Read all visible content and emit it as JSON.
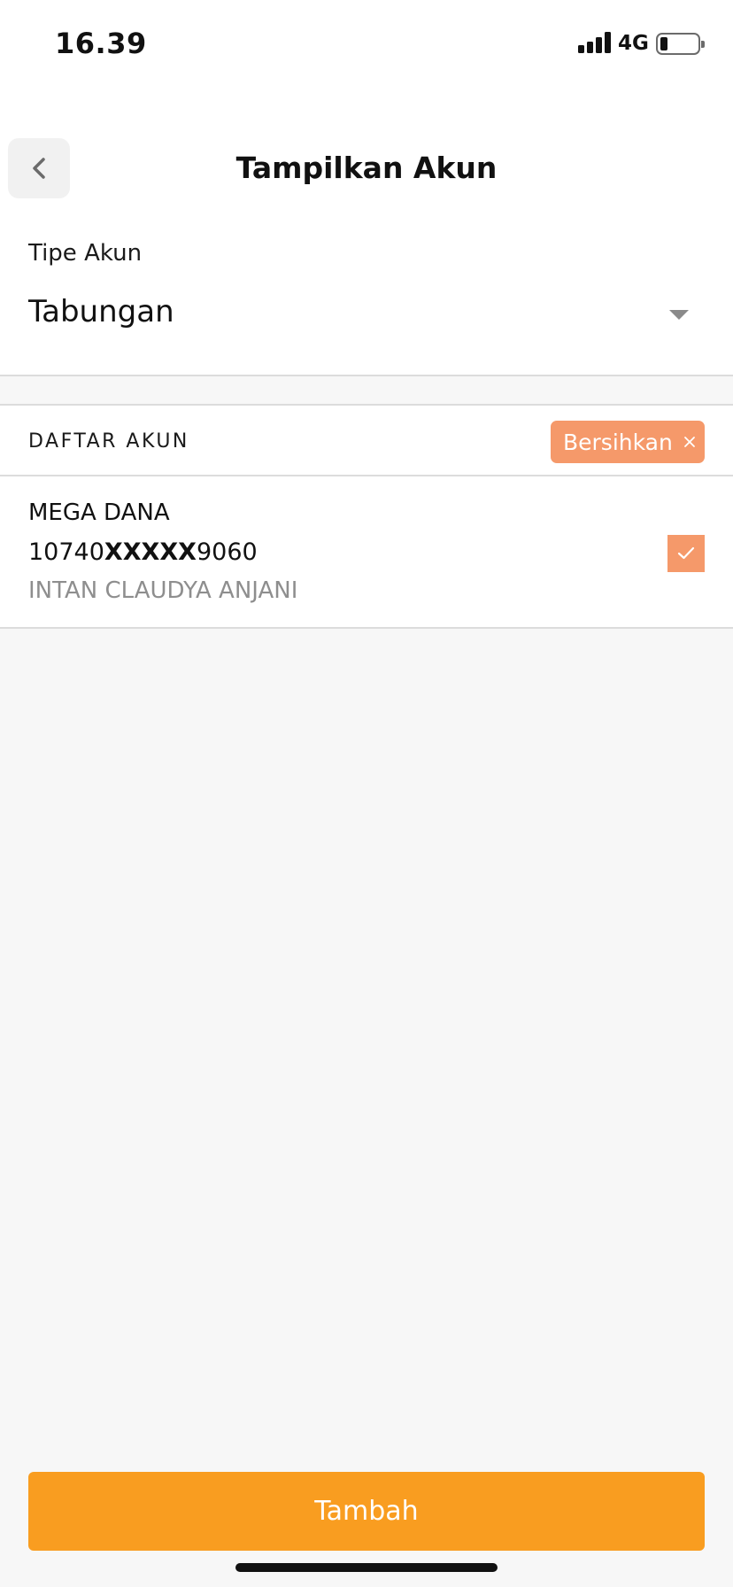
{
  "status_bar": {
    "time": "16.39",
    "network": "4G",
    "battery_fraction": 0.2
  },
  "header": {
    "title": "Tampilkan Akun",
    "back_icon": "chevron-left-icon"
  },
  "account_type": {
    "label": "Tipe Akun",
    "selected": "Tabungan"
  },
  "account_list": {
    "title": "DAFTAR AKUN",
    "clear_label": "Bersihkan",
    "items": [
      {
        "bank": "MEGA DANA",
        "number_prefix": "10740",
        "number_mask": "XXXXX",
        "number_suffix": "9060",
        "holder": "INTAN CLAUDYA ANJANI",
        "checked": true
      }
    ]
  },
  "actions": {
    "add_label": "Tambah"
  },
  "colors": {
    "accent": "#f99d20",
    "accent_soft": "#f5996a",
    "background": "#f7f7f7"
  }
}
